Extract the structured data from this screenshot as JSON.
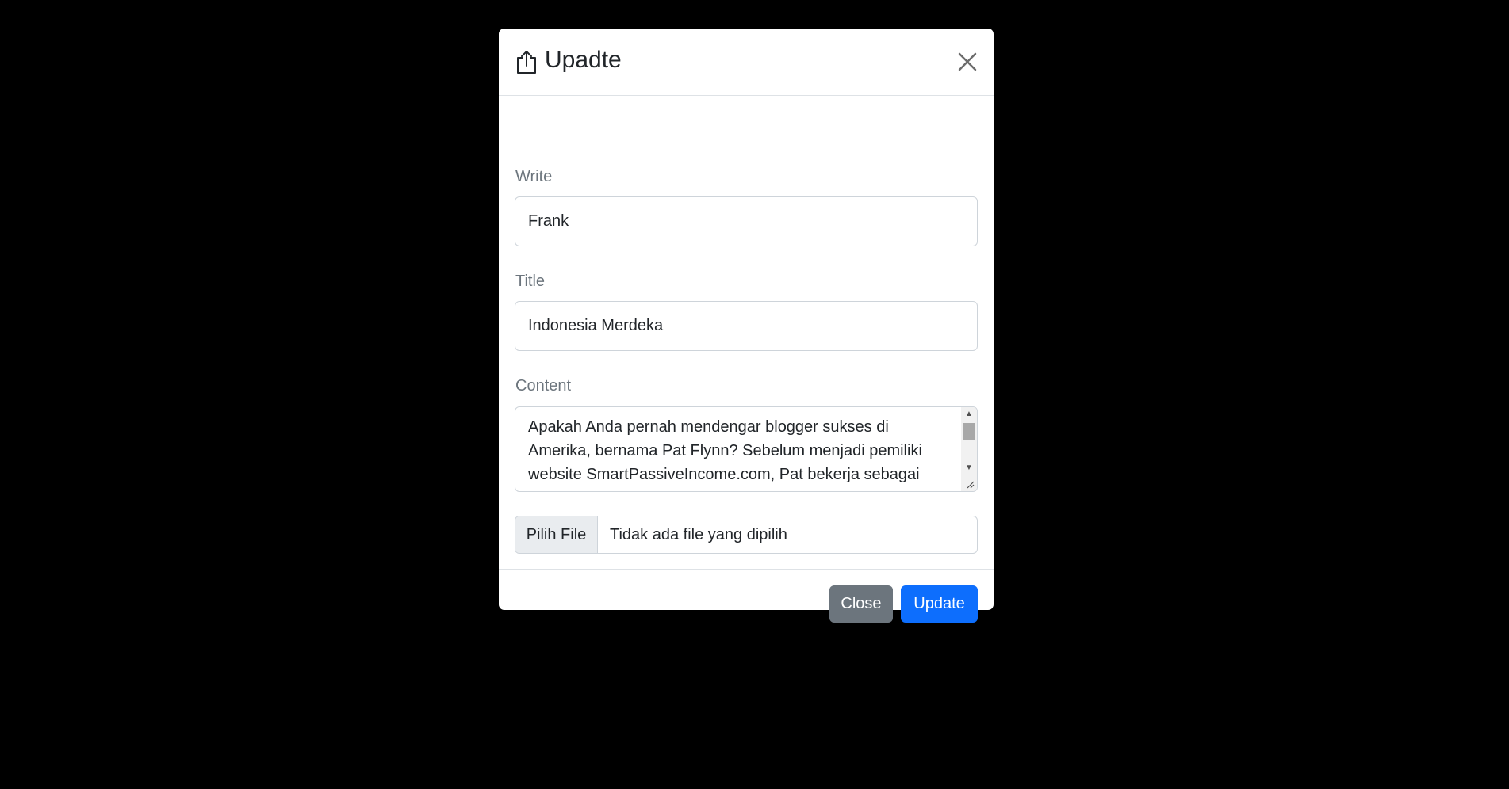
{
  "modal": {
    "title": "Upadte",
    "icon": "upload-icon",
    "close_icon": "close-icon"
  },
  "form": {
    "write_label": "Write",
    "write_value": "Frank",
    "title_label": "Title",
    "title_value": "Indonesia Merdeka",
    "content_label": "Content",
    "content_value": "Apakah Anda pernah mendengar blogger sukses di Amerika, bernama Pat Flynn? Sebelum menjadi pemiliki website SmartPassiveIncome.com, Pat bekerja sebagai",
    "file_button_label": "Pilih File",
    "file_status": "Tidak ada file yang dipilih"
  },
  "footer": {
    "close_label": "Close",
    "update_label": "Update"
  },
  "colors": {
    "backdrop": "#000000",
    "primary": "#0d6efd",
    "secondary": "#6c757d"
  }
}
